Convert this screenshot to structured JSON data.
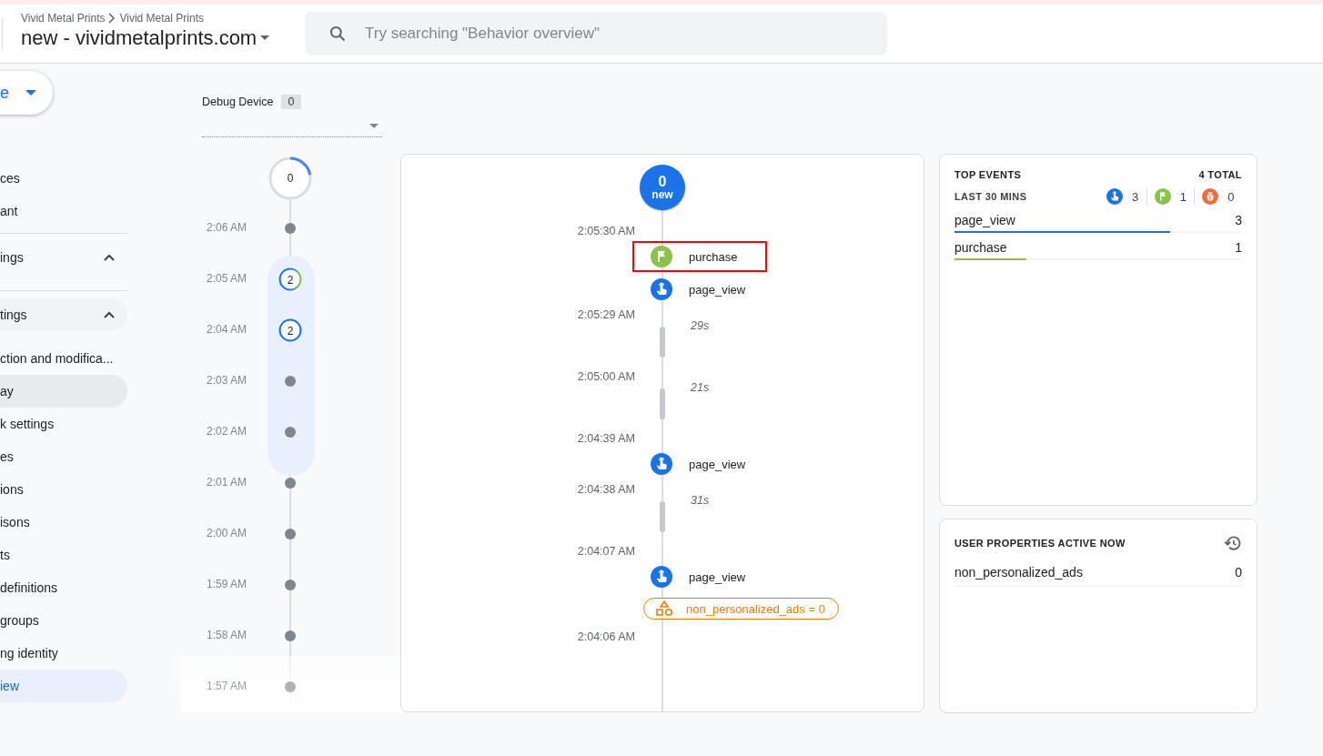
{
  "header": {
    "breadcrumb": [
      "Vivid Metal Prints",
      "Vivid Metal Prints"
    ],
    "property": "new - vividmetalprints.com",
    "search": {
      "placeholder": "Try searching \"Behavior overview\""
    }
  },
  "sidebar": {
    "create_button": "e",
    "items": [
      {
        "kind": "item",
        "label": "ces",
        "selected": false,
        "hovered": false
      },
      {
        "kind": "item",
        "label": "ant",
        "selected": false,
        "hovered": false
      },
      {
        "kind": "section",
        "label": "ings",
        "expanded": true,
        "hovered": false
      },
      {
        "kind": "section",
        "label": "tings",
        "expanded": true,
        "hovered": true
      },
      {
        "kind": "item",
        "label": "ction and modifica...",
        "selected": false,
        "hovered": false
      },
      {
        "kind": "item",
        "label": "ay",
        "selected": false,
        "hovered": true
      },
      {
        "kind": "item",
        "label": "k settings",
        "selected": false,
        "hovered": false
      },
      {
        "kind": "item",
        "label": "es",
        "selected": false,
        "hovered": false
      },
      {
        "kind": "item",
        "label": "ions",
        "selected": false,
        "hovered": false
      },
      {
        "kind": "item",
        "label": "isons",
        "selected": false,
        "hovered": false
      },
      {
        "kind": "item",
        "label": "ts",
        "selected": false,
        "hovered": false
      },
      {
        "kind": "item",
        "label": "definitions",
        "selected": false,
        "hovered": false
      },
      {
        "kind": "item",
        "label": "groups",
        "selected": false,
        "hovered": false
      },
      {
        "kind": "item",
        "label": "ng identity",
        "selected": false,
        "hovered": false
      },
      {
        "kind": "item",
        "label": "iew",
        "selected": true,
        "hovered": false
      }
    ]
  },
  "debug_device": {
    "label": "Debug Device",
    "count": "0"
  },
  "minutes": {
    "counter": {
      "value": "0",
      "level": 0.22
    },
    "rows": [
      {
        "kind": "dot",
        "time": "2:06 AM",
        "selected": false
      },
      {
        "kind": "mixed",
        "time": "2:05 AM",
        "count": "2",
        "selected": true
      },
      {
        "kind": "events",
        "time": "2:04 AM",
        "count": "2",
        "selected": true
      },
      {
        "kind": "dot",
        "time": "2:03 AM",
        "selected": true
      },
      {
        "kind": "dot",
        "time": "2:02 AM",
        "selected": true
      },
      {
        "kind": "dot",
        "time": "2:01 AM",
        "selected": false
      },
      {
        "kind": "dot",
        "time": "2:00 AM",
        "selected": false
      },
      {
        "kind": "dot",
        "time": "1:59 AM",
        "selected": false
      },
      {
        "kind": "dot",
        "time": "1:58 AM",
        "selected": false
      },
      {
        "kind": "dot",
        "time": "1:57 AM",
        "selected": false
      }
    ]
  },
  "stream": {
    "bubble": {
      "count": "0",
      "label": "new"
    },
    "entries": [
      {
        "kind": "time",
        "text": "2:05:30 AM"
      },
      {
        "kind": "conversion",
        "text": "purchase",
        "highlighted": true
      },
      {
        "kind": "event",
        "text": "page_view",
        "highlighted": false
      },
      {
        "kind": "time",
        "text": "2:05:29 AM"
      },
      {
        "kind": "gap",
        "text": "29s"
      },
      {
        "kind": "time",
        "text": "2:05:00 AM"
      },
      {
        "kind": "gap",
        "text": "21s"
      },
      {
        "kind": "time",
        "text": "2:04:39 AM"
      },
      {
        "kind": "event",
        "text": "page_view",
        "highlighted": false
      },
      {
        "kind": "time",
        "text": "2:04:38 AM"
      },
      {
        "kind": "gap",
        "text": "31s"
      },
      {
        "kind": "time",
        "text": "2:04:07 AM"
      },
      {
        "kind": "event",
        "text": "page_view",
        "highlighted": false
      },
      {
        "kind": "property",
        "text": "non_personalized_ads = 0"
      },
      {
        "kind": "time",
        "text": "2:04:06 AM"
      }
    ]
  },
  "top_events": {
    "title": "TOP EVENTS",
    "total": "4 TOTAL",
    "period": "LAST 30 MINS",
    "counts": [
      {
        "kind": "event",
        "count": "3"
      },
      {
        "kind": "conversion",
        "count": "1"
      },
      {
        "kind": "error",
        "count": "0"
      }
    ],
    "rows": [
      {
        "name": "page_view",
        "count": "3",
        "level": 0.75,
        "color": "#1a73e8"
      },
      {
        "name": "purchase",
        "count": "1",
        "level": 0.25,
        "color": "#8bc34a"
      }
    ]
  },
  "user_properties": {
    "title": "USER PROPERTIES ACTIVE NOW",
    "rows": [
      {
        "name": "non_personalized_ads",
        "value": "0"
      }
    ]
  }
}
